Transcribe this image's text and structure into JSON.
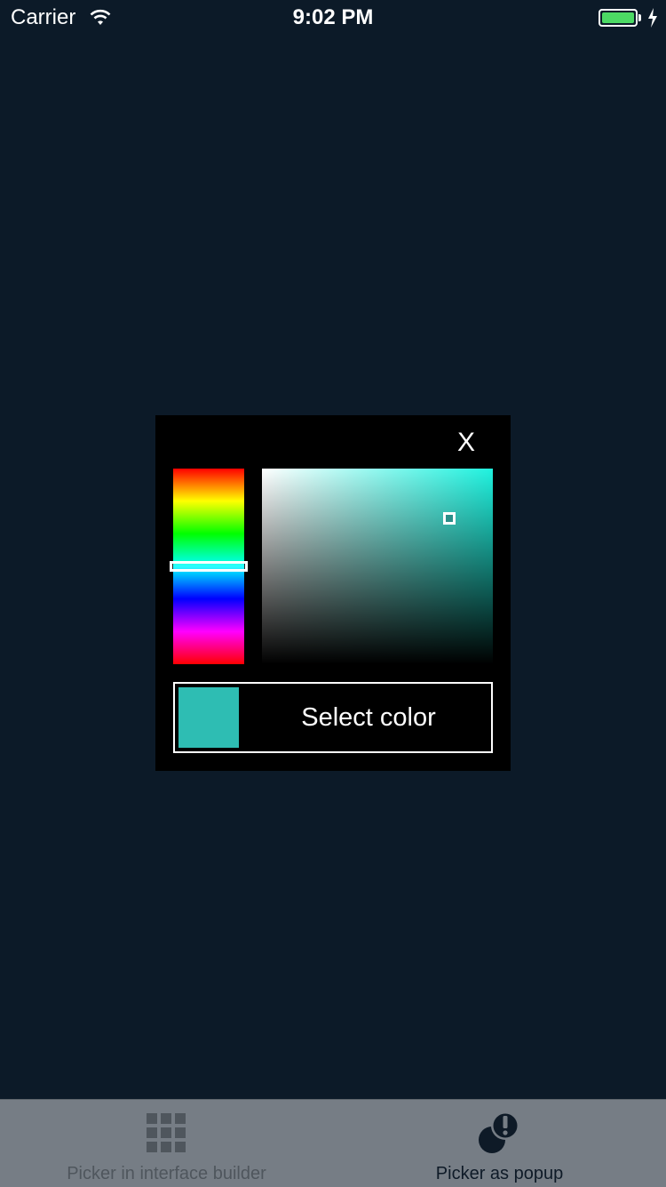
{
  "status_bar": {
    "carrier": "Carrier",
    "time": "9:02 PM",
    "battery_color": "#4cd964",
    "icons": [
      "wifi-icon",
      "battery-icon",
      "charging-icon"
    ]
  },
  "popup": {
    "close_label": "X",
    "select_label": "Select color",
    "selected_color": "#2ebdb3",
    "hue_level": 0.5,
    "saturation": 0.87,
    "brightness": 0.75
  },
  "tab_bar": {
    "tabs": [
      {
        "label": "Picker in interface builder",
        "icon": "grid-icon",
        "selected": false
      },
      {
        "label": "Picker as popup",
        "icon": "popup-alert-icon",
        "selected": true
      }
    ]
  },
  "colors": {
    "background": "#0c1a28",
    "popup_background": "#000000",
    "tab_bar_background": "#767d85",
    "tab_selected": "#0e1a27",
    "tab_unselected": "#4f565d"
  }
}
